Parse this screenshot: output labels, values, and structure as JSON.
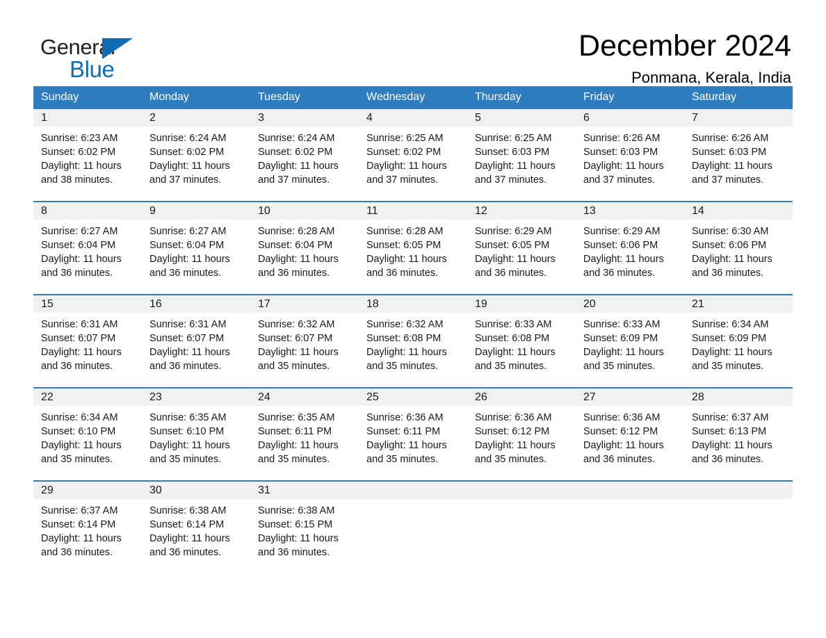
{
  "brand": {
    "name_top": "General",
    "name_bottom": "Blue",
    "accent_color": "#0f6cb5"
  },
  "header": {
    "title": "December 2024",
    "location": "Ponmana, Kerala, India"
  },
  "calendar": {
    "header_bg": "#2f7cbf",
    "daynum_bg": "#f1f1f1",
    "weekdays": [
      "Sunday",
      "Monday",
      "Tuesday",
      "Wednesday",
      "Thursday",
      "Friday",
      "Saturday"
    ],
    "weeks": [
      [
        {
          "day": "1",
          "sunrise": "Sunrise: 6:23 AM",
          "sunset": "Sunset: 6:02 PM",
          "daylight_line1": "Daylight: 11 hours",
          "daylight_line2": "and 38 minutes."
        },
        {
          "day": "2",
          "sunrise": "Sunrise: 6:24 AM",
          "sunset": "Sunset: 6:02 PM",
          "daylight_line1": "Daylight: 11 hours",
          "daylight_line2": "and 37 minutes."
        },
        {
          "day": "3",
          "sunrise": "Sunrise: 6:24 AM",
          "sunset": "Sunset: 6:02 PM",
          "daylight_line1": "Daylight: 11 hours",
          "daylight_line2": "and 37 minutes."
        },
        {
          "day": "4",
          "sunrise": "Sunrise: 6:25 AM",
          "sunset": "Sunset: 6:02 PM",
          "daylight_line1": "Daylight: 11 hours",
          "daylight_line2": "and 37 minutes."
        },
        {
          "day": "5",
          "sunrise": "Sunrise: 6:25 AM",
          "sunset": "Sunset: 6:03 PM",
          "daylight_line1": "Daylight: 11 hours",
          "daylight_line2": "and 37 minutes."
        },
        {
          "day": "6",
          "sunrise": "Sunrise: 6:26 AM",
          "sunset": "Sunset: 6:03 PM",
          "daylight_line1": "Daylight: 11 hours",
          "daylight_line2": "and 37 minutes."
        },
        {
          "day": "7",
          "sunrise": "Sunrise: 6:26 AM",
          "sunset": "Sunset: 6:03 PM",
          "daylight_line1": "Daylight: 11 hours",
          "daylight_line2": "and 37 minutes."
        }
      ],
      [
        {
          "day": "8",
          "sunrise": "Sunrise: 6:27 AM",
          "sunset": "Sunset: 6:04 PM",
          "daylight_line1": "Daylight: 11 hours",
          "daylight_line2": "and 36 minutes."
        },
        {
          "day": "9",
          "sunrise": "Sunrise: 6:27 AM",
          "sunset": "Sunset: 6:04 PM",
          "daylight_line1": "Daylight: 11 hours",
          "daylight_line2": "and 36 minutes."
        },
        {
          "day": "10",
          "sunrise": "Sunrise: 6:28 AM",
          "sunset": "Sunset: 6:04 PM",
          "daylight_line1": "Daylight: 11 hours",
          "daylight_line2": "and 36 minutes."
        },
        {
          "day": "11",
          "sunrise": "Sunrise: 6:28 AM",
          "sunset": "Sunset: 6:05 PM",
          "daylight_line1": "Daylight: 11 hours",
          "daylight_line2": "and 36 minutes."
        },
        {
          "day": "12",
          "sunrise": "Sunrise: 6:29 AM",
          "sunset": "Sunset: 6:05 PM",
          "daylight_line1": "Daylight: 11 hours",
          "daylight_line2": "and 36 minutes."
        },
        {
          "day": "13",
          "sunrise": "Sunrise: 6:29 AM",
          "sunset": "Sunset: 6:06 PM",
          "daylight_line1": "Daylight: 11 hours",
          "daylight_line2": "and 36 minutes."
        },
        {
          "day": "14",
          "sunrise": "Sunrise: 6:30 AM",
          "sunset": "Sunset: 6:06 PM",
          "daylight_line1": "Daylight: 11 hours",
          "daylight_line2": "and 36 minutes."
        }
      ],
      [
        {
          "day": "15",
          "sunrise": "Sunrise: 6:31 AM",
          "sunset": "Sunset: 6:07 PM",
          "daylight_line1": "Daylight: 11 hours",
          "daylight_line2": "and 36 minutes."
        },
        {
          "day": "16",
          "sunrise": "Sunrise: 6:31 AM",
          "sunset": "Sunset: 6:07 PM",
          "daylight_line1": "Daylight: 11 hours",
          "daylight_line2": "and 36 minutes."
        },
        {
          "day": "17",
          "sunrise": "Sunrise: 6:32 AM",
          "sunset": "Sunset: 6:07 PM",
          "daylight_line1": "Daylight: 11 hours",
          "daylight_line2": "and 35 minutes."
        },
        {
          "day": "18",
          "sunrise": "Sunrise: 6:32 AM",
          "sunset": "Sunset: 6:08 PM",
          "daylight_line1": "Daylight: 11 hours",
          "daylight_line2": "and 35 minutes."
        },
        {
          "day": "19",
          "sunrise": "Sunrise: 6:33 AM",
          "sunset": "Sunset: 6:08 PM",
          "daylight_line1": "Daylight: 11 hours",
          "daylight_line2": "and 35 minutes."
        },
        {
          "day": "20",
          "sunrise": "Sunrise: 6:33 AM",
          "sunset": "Sunset: 6:09 PM",
          "daylight_line1": "Daylight: 11 hours",
          "daylight_line2": "and 35 minutes."
        },
        {
          "day": "21",
          "sunrise": "Sunrise: 6:34 AM",
          "sunset": "Sunset: 6:09 PM",
          "daylight_line1": "Daylight: 11 hours",
          "daylight_line2": "and 35 minutes."
        }
      ],
      [
        {
          "day": "22",
          "sunrise": "Sunrise: 6:34 AM",
          "sunset": "Sunset: 6:10 PM",
          "daylight_line1": "Daylight: 11 hours",
          "daylight_line2": "and 35 minutes."
        },
        {
          "day": "23",
          "sunrise": "Sunrise: 6:35 AM",
          "sunset": "Sunset: 6:10 PM",
          "daylight_line1": "Daylight: 11 hours",
          "daylight_line2": "and 35 minutes."
        },
        {
          "day": "24",
          "sunrise": "Sunrise: 6:35 AM",
          "sunset": "Sunset: 6:11 PM",
          "daylight_line1": "Daylight: 11 hours",
          "daylight_line2": "and 35 minutes."
        },
        {
          "day": "25",
          "sunrise": "Sunrise: 6:36 AM",
          "sunset": "Sunset: 6:11 PM",
          "daylight_line1": "Daylight: 11 hours",
          "daylight_line2": "and 35 minutes."
        },
        {
          "day": "26",
          "sunrise": "Sunrise: 6:36 AM",
          "sunset": "Sunset: 6:12 PM",
          "daylight_line1": "Daylight: 11 hours",
          "daylight_line2": "and 35 minutes."
        },
        {
          "day": "27",
          "sunrise": "Sunrise: 6:36 AM",
          "sunset": "Sunset: 6:12 PM",
          "daylight_line1": "Daylight: 11 hours",
          "daylight_line2": "and 36 minutes."
        },
        {
          "day": "28",
          "sunrise": "Sunrise: 6:37 AM",
          "sunset": "Sunset: 6:13 PM",
          "daylight_line1": "Daylight: 11 hours",
          "daylight_line2": "and 36 minutes."
        }
      ],
      [
        {
          "day": "29",
          "sunrise": "Sunrise: 6:37 AM",
          "sunset": "Sunset: 6:14 PM",
          "daylight_line1": "Daylight: 11 hours",
          "daylight_line2": "and 36 minutes."
        },
        {
          "day": "30",
          "sunrise": "Sunrise: 6:38 AM",
          "sunset": "Sunset: 6:14 PM",
          "daylight_line1": "Daylight: 11 hours",
          "daylight_line2": "and 36 minutes."
        },
        {
          "day": "31",
          "sunrise": "Sunrise: 6:38 AM",
          "sunset": "Sunset: 6:15 PM",
          "daylight_line1": "Daylight: 11 hours",
          "daylight_line2": "and 36 minutes."
        },
        {
          "day": "",
          "sunrise": "",
          "sunset": "",
          "daylight_line1": "",
          "daylight_line2": ""
        },
        {
          "day": "",
          "sunrise": "",
          "sunset": "",
          "daylight_line1": "",
          "daylight_line2": ""
        },
        {
          "day": "",
          "sunrise": "",
          "sunset": "",
          "daylight_line1": "",
          "daylight_line2": ""
        },
        {
          "day": "",
          "sunrise": "",
          "sunset": "",
          "daylight_line1": "",
          "daylight_line2": ""
        }
      ]
    ]
  }
}
